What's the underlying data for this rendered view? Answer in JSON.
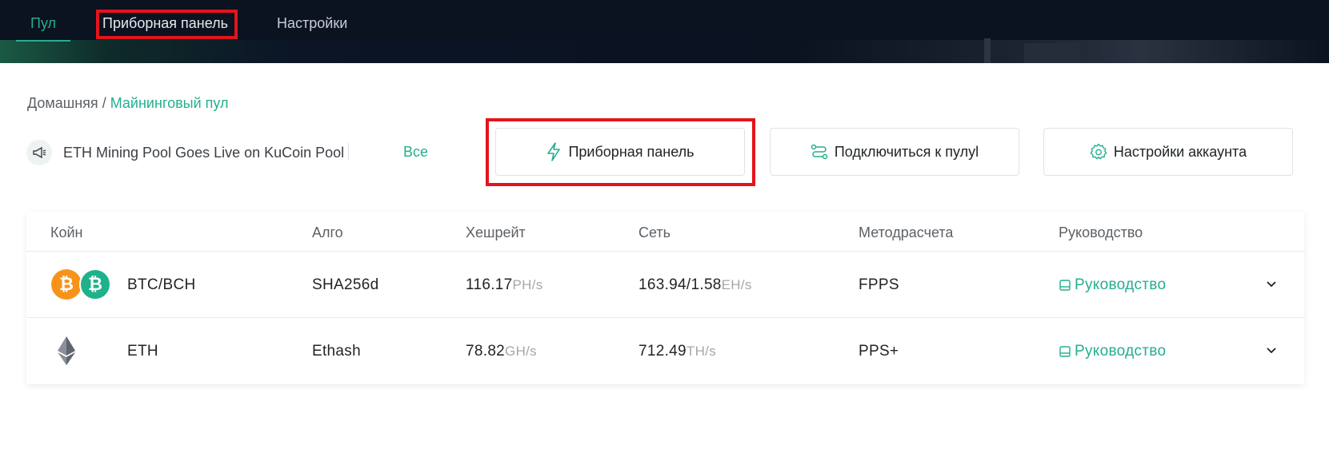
{
  "nav": {
    "tabs": [
      {
        "label": "Пул",
        "active": true
      },
      {
        "label": "Приборная панель",
        "active": false
      },
      {
        "label": "Настройки",
        "active": false
      }
    ]
  },
  "breadcrumb": {
    "home": "Домашняя",
    "separator": "/",
    "current": "Майнинговый пул"
  },
  "announcement": {
    "icon": "megaphone-icon",
    "text": "ETH Mining Pool Goes Live on KuCoin Pool",
    "all_link": "Все"
  },
  "actions": {
    "dashboard": {
      "label": "Приборная панель",
      "icon": "lightning-icon"
    },
    "connect": {
      "label": "Подключиться к пулуl",
      "icon": "connect-icon"
    },
    "account": {
      "label": "Настройки аккаунта",
      "icon": "gear-icon"
    }
  },
  "table": {
    "headers": [
      "Койн",
      "Алго",
      "Хешрейт",
      "Сеть",
      "Методрасчета",
      "Руководство"
    ],
    "rows": [
      {
        "coin": "BTC/BCH",
        "algo": "SHA256d",
        "hashrate": "116.17",
        "hashrate_unit": "PH/s",
        "network": "163.94/1.58",
        "network_unit": "EH/s",
        "method": "FPPS",
        "guide": "Руководство"
      },
      {
        "coin": "ETH",
        "algo": "Ethash",
        "hashrate": "78.82",
        "hashrate_unit": "GH/s",
        "network": "712.49",
        "network_unit": "TH/s",
        "method": "PPS+",
        "guide": "Руководство"
      }
    ]
  },
  "colors": {
    "accent": "#24ae8f",
    "nav_bg": "#0b1220",
    "highlight": "#e3141d",
    "btc": "#f7931a",
    "bch": "#1fb18a"
  }
}
